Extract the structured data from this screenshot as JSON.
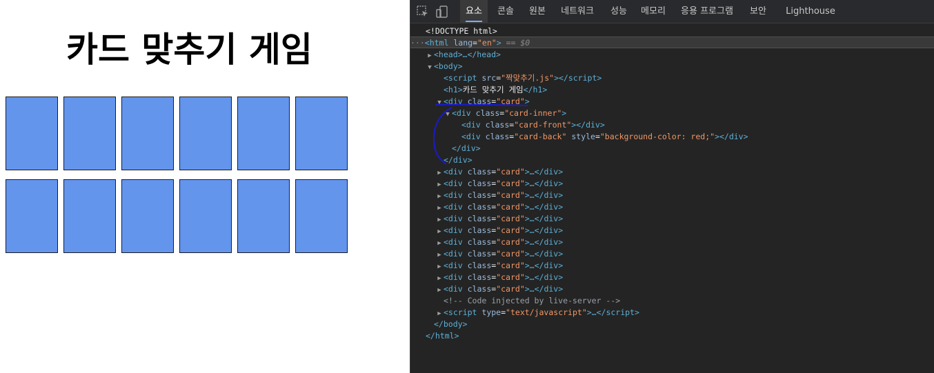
{
  "page": {
    "title": "카드 맞추기 게임",
    "card_color": "#6495ED",
    "card_count": 12
  },
  "devtools": {
    "tabs": [
      {
        "label": "요소",
        "active": true
      },
      {
        "label": "콘솔",
        "active": false
      },
      {
        "label": "원본",
        "active": false
      },
      {
        "label": "네트워크",
        "active": false
      },
      {
        "label": "성능",
        "active": false
      },
      {
        "label": "메모리",
        "active": false
      },
      {
        "label": "응용 프로그램",
        "active": false
      },
      {
        "label": "보안",
        "active": false
      },
      {
        "label": "Lighthouse",
        "active": false
      }
    ],
    "icons": [
      "inspect-element-icon",
      "device-toolbar-icon"
    ],
    "tree": {
      "doctype": "<!DOCTYPE html>",
      "html_open": "<html",
      "html_lang_attr": "lang",
      "html_lang_val": "\"en\"",
      "selected_marker": "== $0",
      "head": "<head>…</head>",
      "body_open": "<body>",
      "script_src_attr": "src",
      "script_src_val": "\"짝맞추기.js\"",
      "h1_text": "카드 맞추기 게임",
      "card_class_val": "\"card\"",
      "card_inner_val": "\"card-inner\"",
      "card_front_val": "\"card-front\"",
      "card_back_val": "\"card-back\"",
      "style_attr": "style",
      "style_val": "\"background-color: red;\"",
      "collapsed_card_count": 11,
      "comment": "<!-- Code injected by live-server -->",
      "script_type_val": "\"text/javascript\"",
      "body_close": "</body>",
      "html_close": "</html>"
    }
  }
}
